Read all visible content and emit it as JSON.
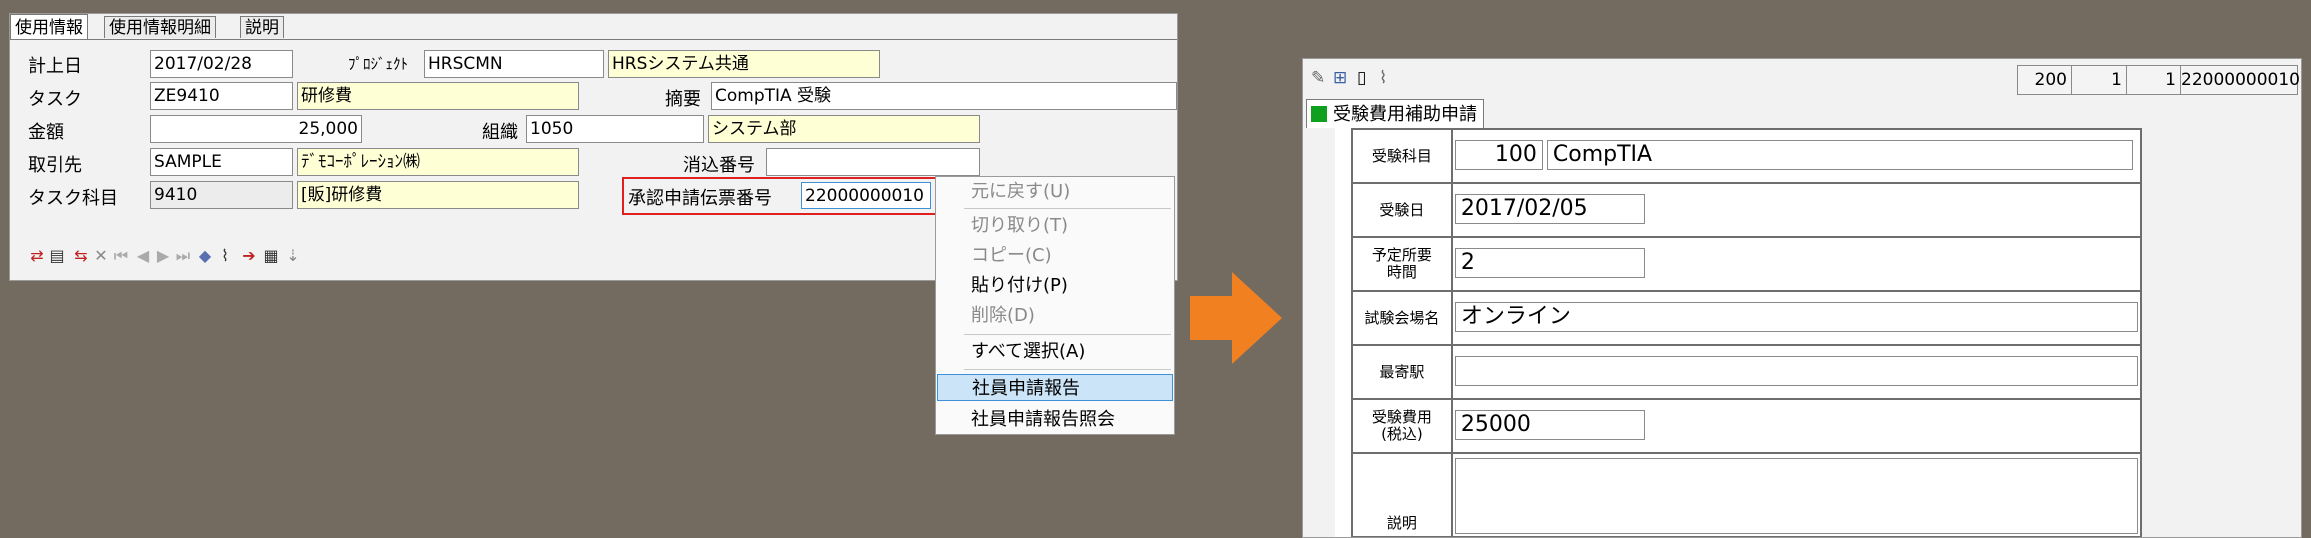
{
  "left_window": {
    "tabs": [
      "使用情報",
      "使用情報明細",
      "説明"
    ],
    "fields": {
      "keijo_date": {
        "label": "計上日",
        "value": "2017/02/28"
      },
      "project": {
        "label": "ﾌﾟﾛｼﾞｪｸﾄ",
        "code": "HRSCMN",
        "name": "HRSシステム共通"
      },
      "task": {
        "label": "タスク",
        "code": "ZE9410",
        "name": "研修費"
      },
      "summary": {
        "label": "摘要",
        "value": "CompTIA 受験"
      },
      "amount": {
        "label": "金額",
        "value": "25,000"
      },
      "org": {
        "label": "組織",
        "code": "1050",
        "name": "システム部"
      },
      "partner": {
        "label": "取引先",
        "code": "SAMPLE",
        "name": "ﾃﾞﾓｺｰﾎﾟﾚｰｼｮﾝ㈱"
      },
      "offset_no": {
        "label": "消込番号",
        "value": ""
      },
      "task_account": {
        "label": "タスク科目",
        "code": "9410",
        "name": "[販]研修費"
      },
      "approval_no": {
        "label": "承認申請伝票番号",
        "value": "22000000010"
      }
    },
    "toolbar_icons": [
      "insert-row-icon",
      "copy-row-icon",
      "delete-mark-icon",
      "close-x-icon",
      "first-icon",
      "prev-icon",
      "next-icon",
      "last-icon",
      "layers-icon",
      "clip-icon",
      "import-icon",
      "paste-icon",
      "export-icon"
    ]
  },
  "context_menu": {
    "items": [
      {
        "label": "元に戻す(U)",
        "disabled": true
      },
      {
        "label": "切り取り(T)",
        "disabled": true
      },
      {
        "label": "コピー(C)",
        "disabled": true
      },
      {
        "label": "貼り付け(P)",
        "disabled": false
      },
      {
        "label": "削除(D)",
        "disabled": true
      },
      {
        "label": "すべて選択(A)",
        "disabled": false
      },
      {
        "label": "社員申請報告",
        "disabled": false,
        "highlighted": true
      },
      {
        "label": "社員申請報告照会",
        "disabled": false
      }
    ]
  },
  "arrow_color": "#f08020",
  "right_window": {
    "toolbar_icons": [
      "edit-icon",
      "book-icon",
      "document-icon",
      "attach-icon"
    ],
    "counters": [
      "200",
      "1",
      "1",
      "22000000010"
    ],
    "tab_label": "受験費用補助申請",
    "form": {
      "subject": {
        "label": "受験科目",
        "code": "100",
        "name": "CompTIA"
      },
      "exam_date": {
        "label": "受験日",
        "value": "2017/02/05"
      },
      "planned_hours": {
        "label": "予定所要時間",
        "value": "2"
      },
      "venue": {
        "label": "試験会場名",
        "value": "オンライン"
      },
      "nearest_station": {
        "label": "最寄駅",
        "value": ""
      },
      "exam_fee": {
        "label": "受験費用(税込)",
        "value": "25000"
      },
      "description": {
        "label": "説明",
        "value": ""
      }
    }
  }
}
